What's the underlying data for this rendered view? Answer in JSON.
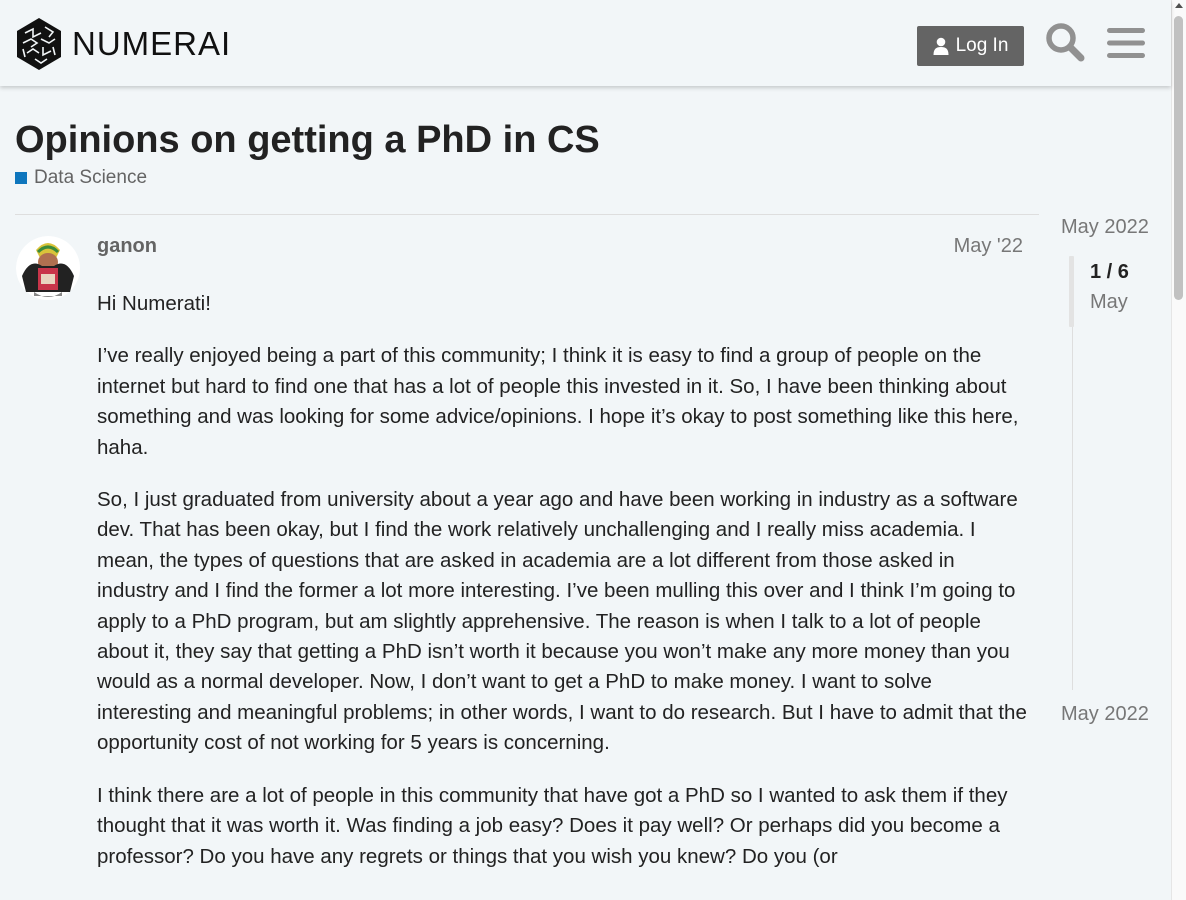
{
  "header": {
    "brand": "NUMERAI",
    "login_label": "Log In",
    "icons": {
      "logo": "numerai-cube-logo",
      "user": "user-icon",
      "search": "search-icon",
      "menu": "hamburger-menu-icon"
    }
  },
  "topic": {
    "title": "Opinions on getting a PhD in CS",
    "category": "Data Science",
    "category_color": "#0e76bd"
  },
  "post": {
    "username": "ganon",
    "date": "May '22",
    "paragraphs": [
      "Hi Numerati!",
      "I’ve really enjoyed being a part of this community; I think it is easy to find a group of people on the internet but hard to find one that has a lot of people this invested in it. So, I have been thinking about something and was looking for some advice/opinions. I hope it’s okay to post something like this here, haha.",
      "So, I just graduated from university about a year ago and have been working in industry as a software dev. That has been okay, but I find the work relatively unchallenging and I really miss academia. I mean, the types of questions that are asked in academia are a lot different from those asked in industry and I find the former a lot more interesting. I’ve been mulling this over and I think I’m going to apply to a PhD program, but am slightly apprehensive. The reason is when I talk to a lot of people about it, they say that getting a PhD isn’t worth it because you won’t make any more money than you would as a normal developer. Now, I don’t want to get a PhD to make money. I want to solve interesting and meaningful problems; in other words, I want to do research. But I have to admit that the opportunity cost of not working for 5 years is concerning.",
      "I think there are a lot of people in this community that have got a PhD so I wanted to ask them if they thought that it was worth it. Was finding a job easy? Does it pay well? Or perhaps did you become a professor? Do you have any regrets or things that you wish you knew? Do you (or"
    ]
  },
  "timeline": {
    "start": "May 2022",
    "count": "1 / 6",
    "current_month": "May",
    "end": "May 2022"
  }
}
